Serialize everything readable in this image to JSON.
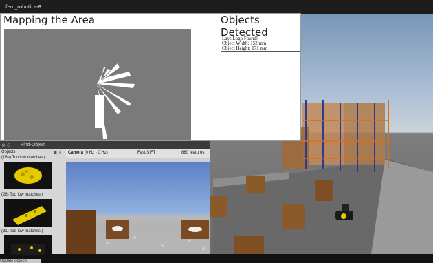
{
  "window": {
    "title": "fem_robotics-8"
  },
  "mapping": {
    "title": "Mapping the Area"
  },
  "objects_panel": {
    "title": "Objects Detected",
    "lines": [
      "Lays Logo Found!",
      "Object Width: 152 mm",
      "Object Height: 171 mm"
    ]
  },
  "find_object": {
    "title": "Find-Object",
    "objects_header": "Objects",
    "items": [
      {
        "label": "(16e)   Too low matches ("
      },
      {
        "label": "(26)   Too low matches ("
      },
      {
        "label": "(31)   Too low matches ("
      }
    ],
    "update_button": "Update objects",
    "camera": {
      "name": "Camera",
      "rate": "(0 Hz - 0 Hz)",
      "detector": "Fast/SIFT",
      "features": "880 features"
    }
  },
  "colors": {
    "map_bg": "#7a7a7a",
    "chip_yellow": "#e5c900",
    "box_brown": "#8b5a2b",
    "rack_blue": "#2e3a8c",
    "rack_orange": "#d8701a"
  }
}
